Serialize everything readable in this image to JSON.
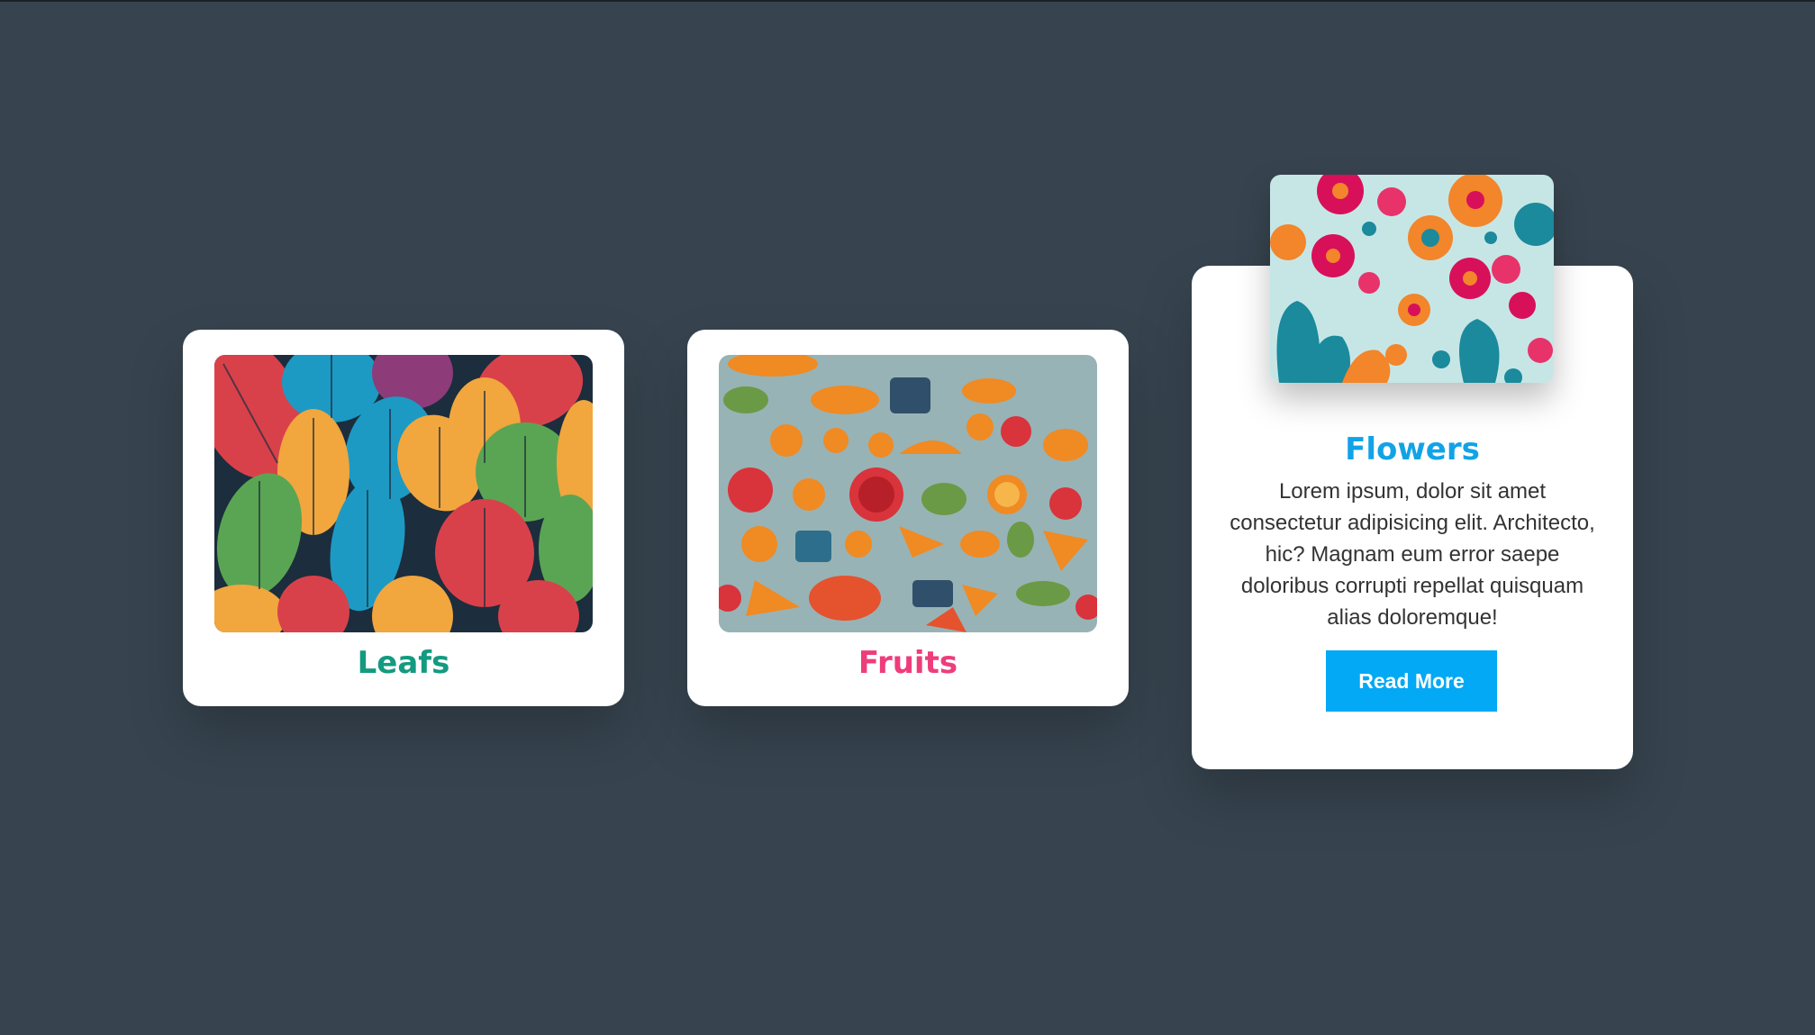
{
  "cards": [
    {
      "title": "Leafs",
      "title_color": "#149a80",
      "image": "leaf-pattern-image"
    },
    {
      "title": "Fruits",
      "title_color": "#ee3d7b",
      "image": "fruit-pattern-image"
    },
    {
      "title": "Flowers",
      "title_color": "#12a3e6",
      "image": "flower-pattern-image",
      "description": "Lorem ipsum, dolor sit amet consectetur adipisicing elit. Architecto, hic? Magnam eum error saepe doloribus corrupti repellat quisquam alias doloremque!",
      "button_label": "Read More",
      "button_color": "#03a9f4"
    }
  ],
  "background_color": "#37444f"
}
